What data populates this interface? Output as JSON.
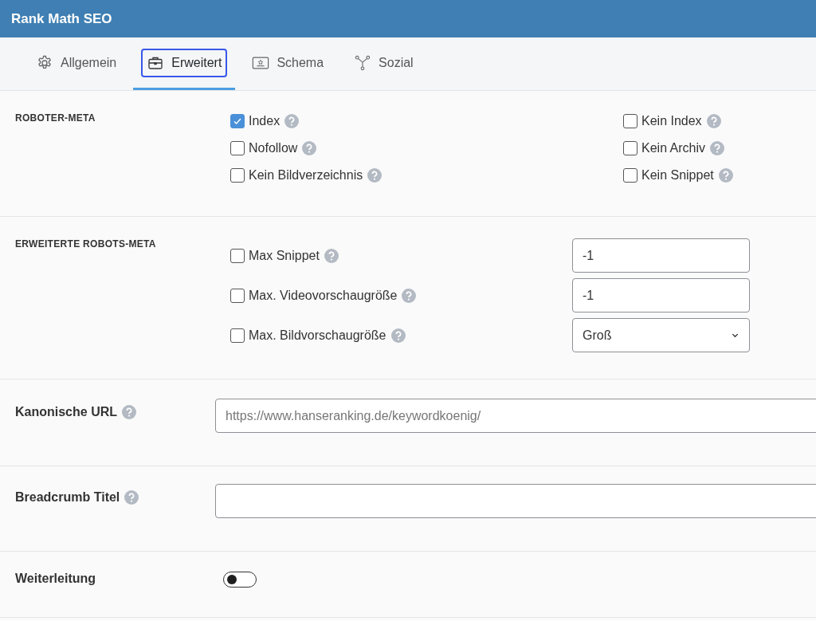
{
  "header": {
    "title": "Rank Math SEO"
  },
  "tabs": [
    {
      "label": "Allgemein",
      "selected": false
    },
    {
      "label": "Erweitert",
      "selected": true
    },
    {
      "label": "Schema",
      "selected": false
    },
    {
      "label": "Sozial",
      "selected": false
    }
  ],
  "robots_meta": {
    "heading": "ROBOTER-META",
    "columns": [
      [
        {
          "label": "Index",
          "checked": true
        },
        {
          "label": "Nofollow",
          "checked": false
        },
        {
          "label": "Kein Bildverzeichnis",
          "checked": false
        }
      ],
      [
        {
          "label": "Kein Index",
          "checked": false
        },
        {
          "label": "Kein Archiv",
          "checked": false
        },
        {
          "label": "Kein Snippet",
          "checked": false
        }
      ]
    ]
  },
  "advanced_robots_meta": {
    "heading": "ERWEITERTE ROBOTS-META",
    "rows": [
      {
        "kind": "text",
        "label": "Max Snippet",
        "checked": false,
        "value": "-1"
      },
      {
        "kind": "text",
        "label": "Max. Videovorschaugröße",
        "checked": false,
        "value": "-1"
      },
      {
        "kind": "select",
        "label": "Max. Bildvorschaugröße",
        "checked": false,
        "value": "Groß"
      }
    ]
  },
  "canonical_url": {
    "label": "Kanonische URL",
    "placeholder": "https://www.hanseranking.de/keywordkoenig/"
  },
  "breadcrumb_title": {
    "label": "Breadcrumb Titel"
  },
  "redirect": {
    "label": "Weiterleitung",
    "on": false
  }
}
